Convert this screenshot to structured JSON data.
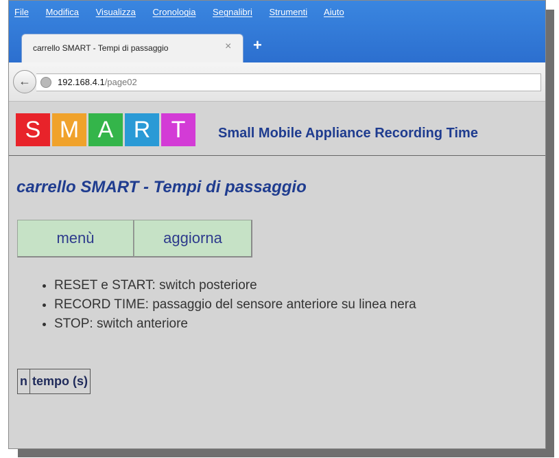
{
  "browser": {
    "menu": [
      "File",
      "Modifica",
      "Visualizza",
      "Cronologia",
      "Segnalibri",
      "Strumenti",
      "Aiuto"
    ],
    "tab": {
      "title": "carrello SMART - Tempi di passaggio",
      "close": "×",
      "new": "+"
    },
    "url": {
      "host": "192.168.4.1",
      "path": "/page02"
    },
    "back": "←"
  },
  "page": {
    "logo": {
      "letters": [
        "S",
        "M",
        "A",
        "R",
        "T"
      ],
      "colors": [
        "#e8232a",
        "#f0a22b",
        "#34b54a",
        "#2a9ad6",
        "#d33bd6"
      ],
      "tagline": "Small Mobile Appliance Recording Time"
    },
    "heading": "carrello SMART - Tempi di passaggio",
    "buttons": {
      "menu": "menù",
      "update": "aggiorna"
    },
    "notes": [
      "RESET e START: switch posteriore",
      "RECORD TIME: passaggio del sensore anteriore su linea nera",
      "STOP: switch anteriore"
    ],
    "table": {
      "headers": [
        "n",
        "tempo (s)"
      ]
    }
  }
}
